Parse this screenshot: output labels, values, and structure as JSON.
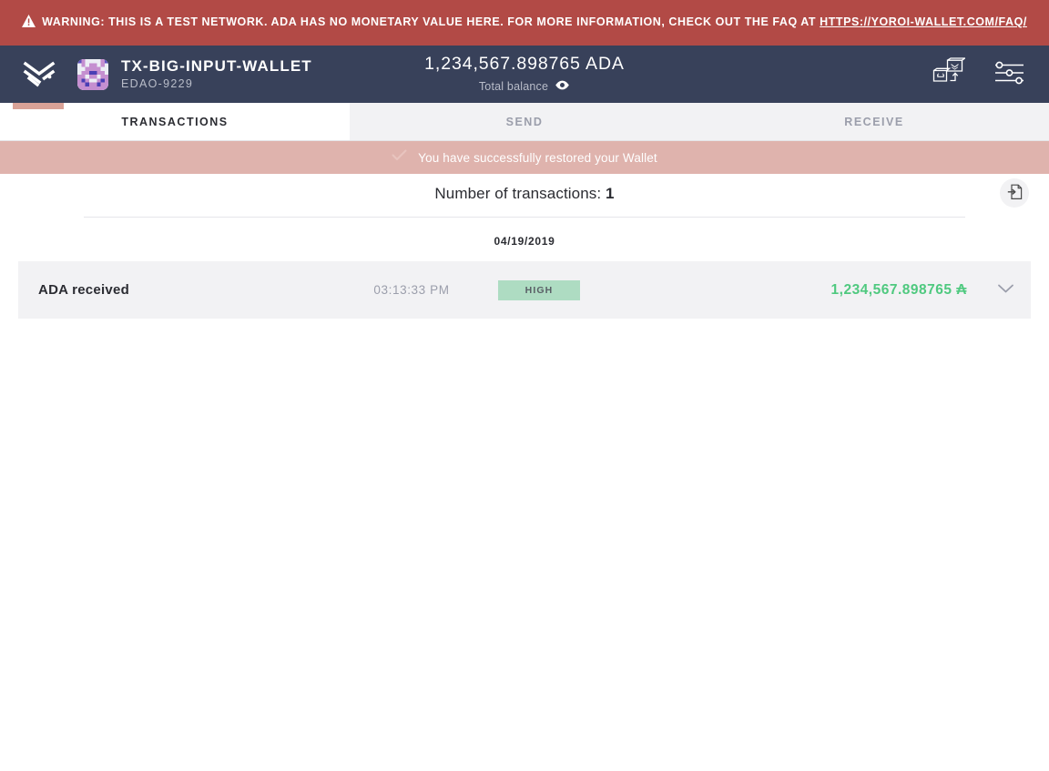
{
  "warning": {
    "icon": "warning-triangle-icon",
    "text_before_link": "WARNING: THIS IS A TEST NETWORK. ADA HAS NO MONETARY VALUE HERE. FOR MORE INFORMATION, CHECK OUT THE FAQ AT ",
    "link_text": "HTTPS://YOROI-WALLET.COM/FAQ/",
    "background_color": "#b24a46",
    "text_color": "#ffffff"
  },
  "header": {
    "logo_icon": "yoroi-logo-icon",
    "avatar_icon": "wallet-identicon-avatar",
    "wallet_name": "TX-BIG-INPUT-WALLET",
    "wallet_plate": "EDAO-9229",
    "balance_amount": "1,234,567.898765 ADA",
    "balance_label": "Total balance",
    "balance_toggle_icon": "eye-icon",
    "switch_wallet_icon": "switch-wallet-icon",
    "settings_icon": "settings-sliders-icon",
    "background_color": "#38415a",
    "accent_color": "#d9a297"
  },
  "tabs": [
    {
      "label": "Transactions",
      "active": true
    },
    {
      "label": "Send",
      "active": false
    },
    {
      "label": "Receive",
      "active": false
    }
  ],
  "notification": {
    "icon": "check-icon",
    "message": "You have successfully restored your Wallet",
    "background_color": "#dfb3ad"
  },
  "transactions_panel": {
    "count_label": "Number of transactions:",
    "count_value": "1",
    "export_icon": "export-transactions-icon",
    "groups": [
      {
        "date": "04/19/2019",
        "rows": [
          {
            "type": "ADA received",
            "time": "03:13:33 PM",
            "status": "HIGH",
            "status_color": "#aedcc2",
            "amount": "1,234,567.898765 ₳",
            "amount_color": "#4fc97f",
            "expand_icon": "chevron-down-icon"
          }
        ]
      }
    ]
  }
}
